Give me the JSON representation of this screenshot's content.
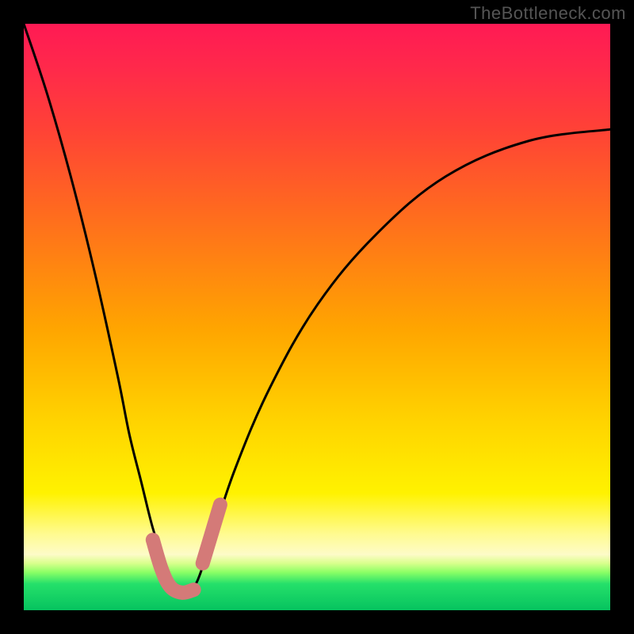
{
  "watermark": "TheBottleneck.com",
  "chart_data": {
    "type": "line",
    "title": "",
    "xlabel": "",
    "ylabel": "",
    "xlim": [
      0,
      100
    ],
    "ylim": [
      0,
      100
    ],
    "grid": false,
    "legend": false,
    "series": [
      {
        "name": "bottleneck-curve",
        "x": [
          0,
          4,
          8,
          12,
          16,
          18,
          20,
          22,
          24,
          26,
          27,
          28,
          29,
          30,
          32,
          36,
          42,
          50,
          60,
          72,
          86,
          100
        ],
        "values": [
          100,
          88,
          74,
          58,
          40,
          30,
          22,
          14,
          8,
          4,
          3,
          3,
          4,
          6,
          12,
          24,
          38,
          52,
          64,
          74,
          80,
          82
        ]
      }
    ],
    "markers": [
      {
        "name": "left-wiggle",
        "color": "#d47a78",
        "x": [
          22,
          23.5,
          25,
          27,
          29
        ],
        "values": [
          12,
          7,
          4,
          3,
          3.5
        ]
      },
      {
        "name": "right-wiggle",
        "color": "#d47a78",
        "x": [
          30.5,
          32,
          33.5
        ],
        "values": [
          8,
          13,
          18
        ]
      }
    ],
    "background_gradient": {
      "stops": [
        {
          "pos": 0.0,
          "color": "#ff1a54"
        },
        {
          "pos": 0.18,
          "color": "#ff4236"
        },
        {
          "pos": 0.52,
          "color": "#ffa500"
        },
        {
          "pos": 0.8,
          "color": "#fff200"
        },
        {
          "pos": 0.905,
          "color": "#fdfbc8"
        },
        {
          "pos": 0.955,
          "color": "#25e06a"
        },
        {
          "pos": 1.0,
          "color": "#06c35f"
        }
      ]
    }
  }
}
